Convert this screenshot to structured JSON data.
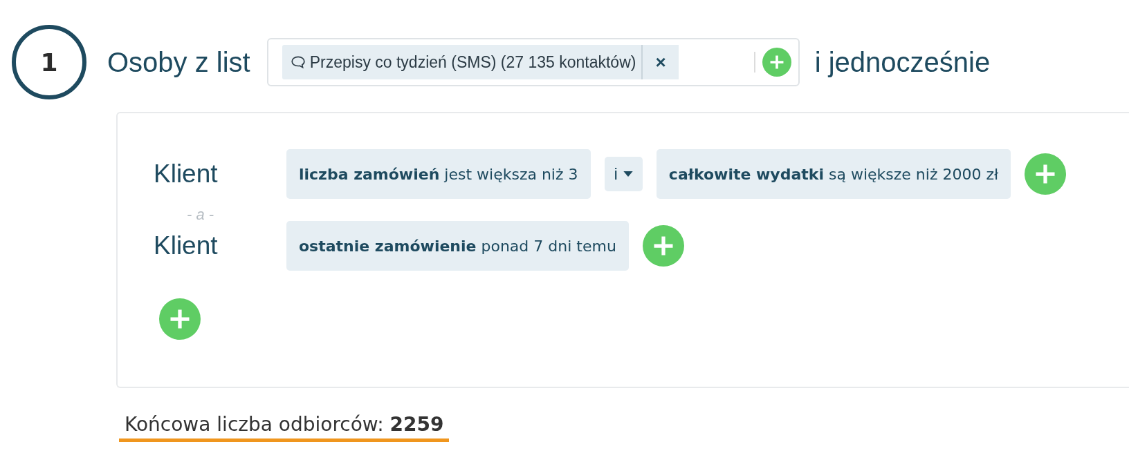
{
  "step": {
    "number": "1"
  },
  "header": {
    "label": "Osoby z list",
    "lists": [
      {
        "name": "Przepisy co tydzień (SMS) (27 135 kontaktów)",
        "remove": "×"
      }
    ],
    "suffix": "i jednocześnie"
  },
  "groups": [
    {
      "subject": "Klient",
      "conditions": [
        {
          "text": "**liczba zamówień** jest większa niż 3"
        },
        {
          "text": "**całkowite wydatki** są większe niż 2000 zł",
          "operator": "i"
        }
      ]
    },
    {
      "join": "- a -",
      "subject": "Klient",
      "conditions": [
        {
          "text": "**ostatnie zamówienie** ponad 7 dni temu"
        }
      ]
    }
  ],
  "result": {
    "text": "Końcowa liczba odbiorców: **2259**"
  }
}
